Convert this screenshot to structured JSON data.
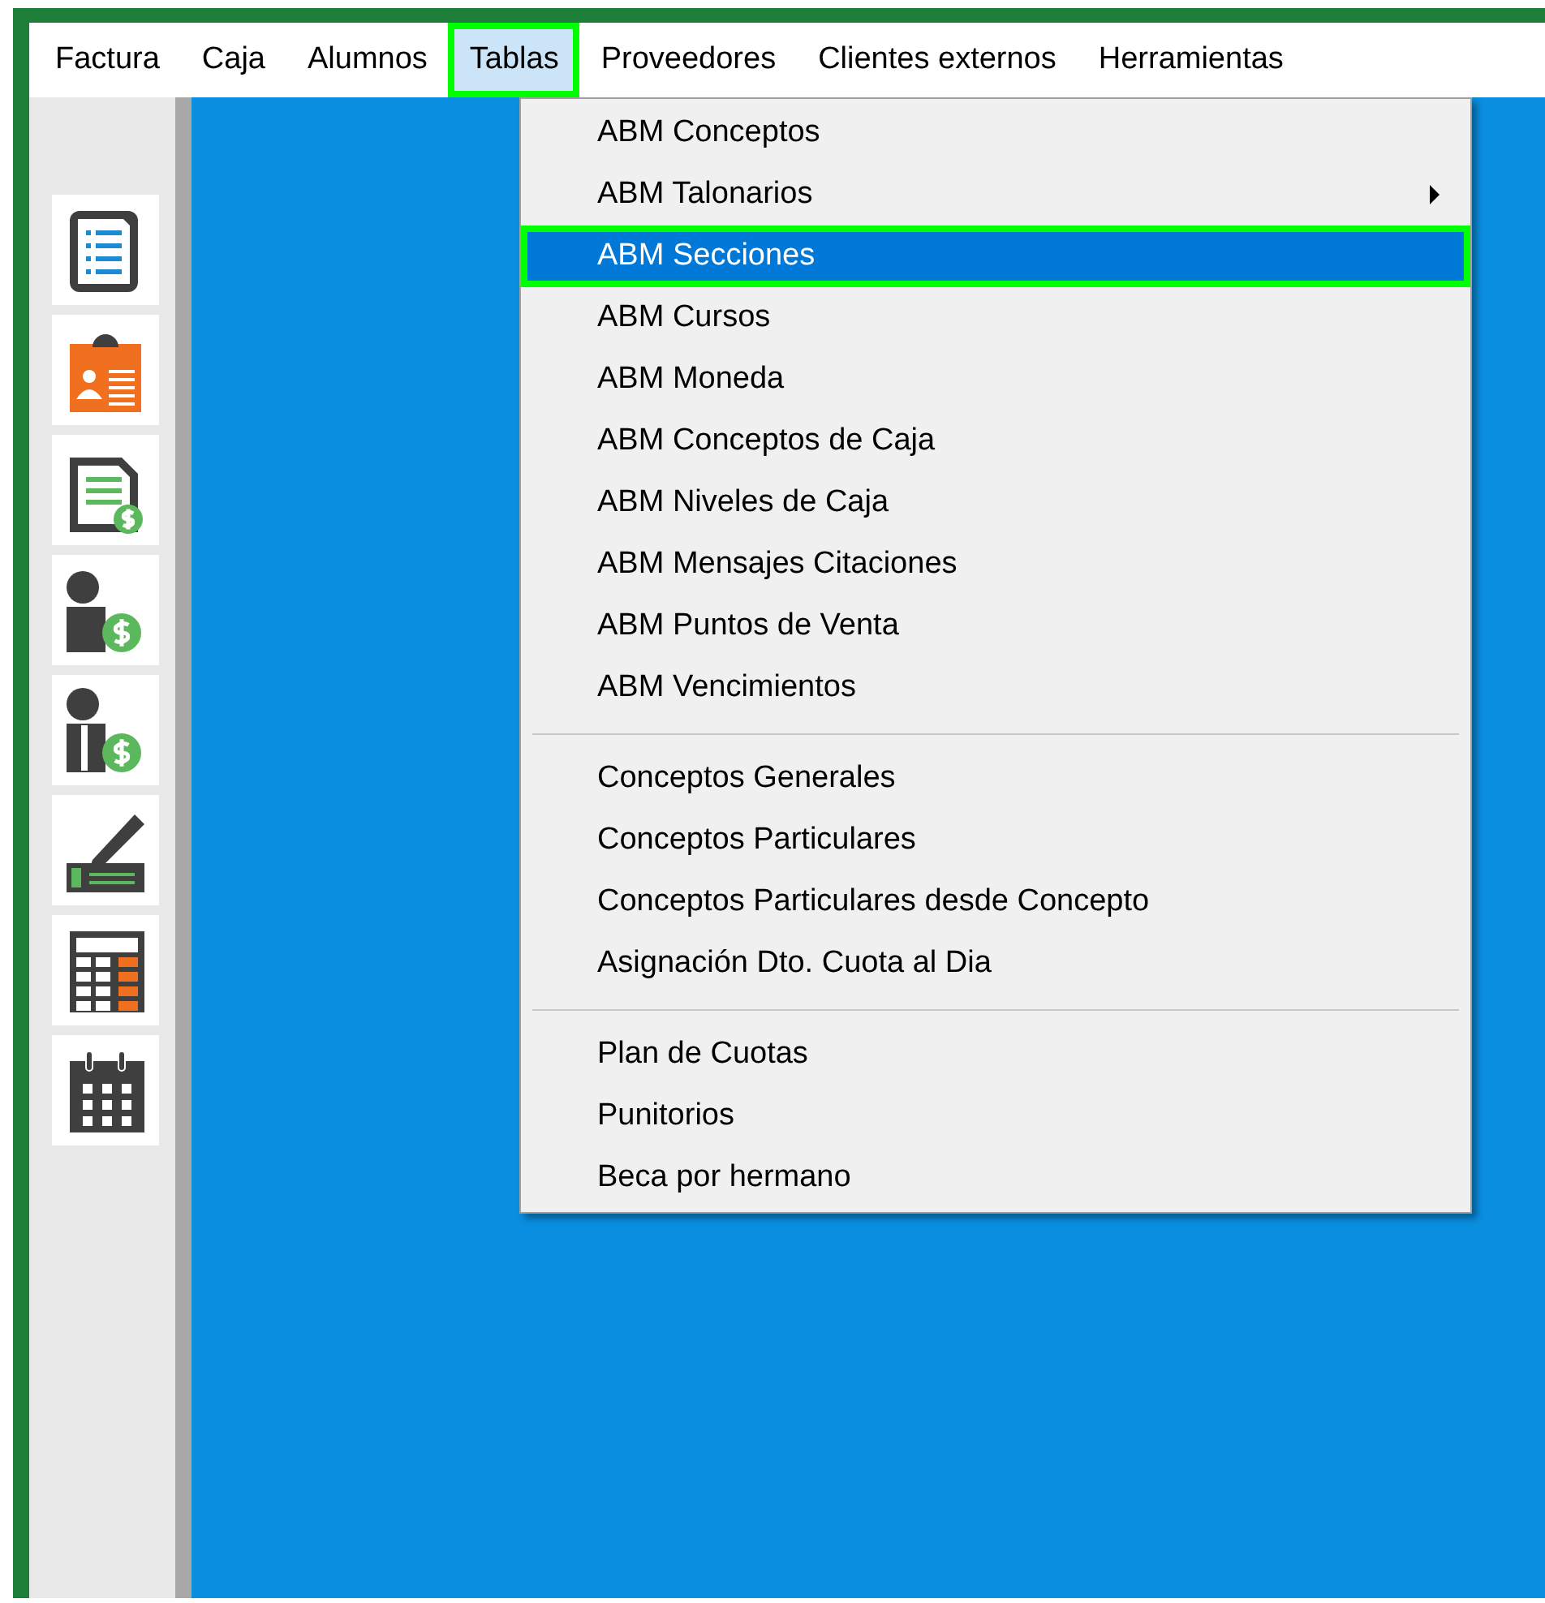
{
  "menu_bar": [
    {
      "label": "Factura",
      "selected": false
    },
    {
      "label": "Caja",
      "selected": false
    },
    {
      "label": "Alumnos",
      "selected": false
    },
    {
      "label": "Tablas",
      "selected": true
    },
    {
      "label": "Proveedores",
      "selected": false
    },
    {
      "label": "Clientes externos",
      "selected": false
    },
    {
      "label": "Herramientas",
      "selected": false
    }
  ],
  "dropdown": [
    {
      "kind": "item",
      "label": "ABM Conceptos",
      "selected": false,
      "submenu": false
    },
    {
      "kind": "item",
      "label": "ABM Talonarios",
      "selected": false,
      "submenu": true
    },
    {
      "kind": "item",
      "label": "ABM Secciones",
      "selected": true,
      "submenu": false
    },
    {
      "kind": "item",
      "label": "ABM Cursos",
      "selected": false,
      "submenu": false
    },
    {
      "kind": "item",
      "label": "ABM Moneda",
      "selected": false,
      "submenu": false
    },
    {
      "kind": "item",
      "label": "ABM Conceptos de Caja",
      "selected": false,
      "submenu": false
    },
    {
      "kind": "item",
      "label": "ABM Niveles de Caja",
      "selected": false,
      "submenu": false
    },
    {
      "kind": "item",
      "label": "ABM Mensajes Citaciones",
      "selected": false,
      "submenu": false
    },
    {
      "kind": "item",
      "label": "ABM Puntos de Venta",
      "selected": false,
      "submenu": false
    },
    {
      "kind": "item",
      "label": "ABM Vencimientos",
      "selected": false,
      "submenu": false
    },
    {
      "kind": "separator"
    },
    {
      "kind": "item",
      "label": "Conceptos Generales",
      "selected": false,
      "submenu": false
    },
    {
      "kind": "item",
      "label": "Conceptos Particulares",
      "selected": false,
      "submenu": false
    },
    {
      "kind": "item",
      "label": "Conceptos Particulares desde Concepto",
      "selected": false,
      "submenu": false
    },
    {
      "kind": "item",
      "label": "Asignación Dto. Cuota al Dia",
      "selected": false,
      "submenu": false
    },
    {
      "kind": "separator"
    },
    {
      "kind": "item",
      "label": "Plan de Cuotas",
      "selected": false,
      "submenu": false
    },
    {
      "kind": "item",
      "label": "Punitorios",
      "selected": false,
      "submenu": false
    },
    {
      "kind": "item",
      "label": "Beca por hermano",
      "selected": false,
      "submenu": false
    }
  ]
}
